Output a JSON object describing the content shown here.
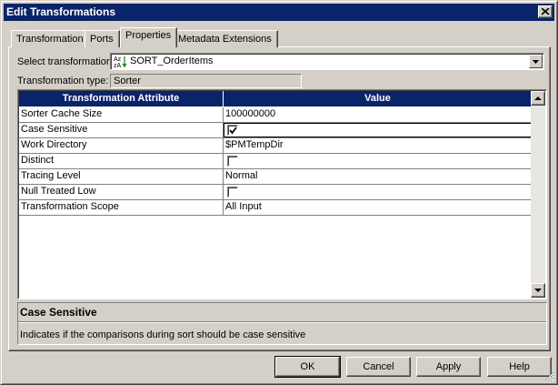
{
  "window": {
    "title": "Edit Transformations"
  },
  "tabs": [
    {
      "label": "Transformation"
    },
    {
      "label": "Ports"
    },
    {
      "label": "Properties",
      "active": true
    },
    {
      "label": "Metadata Extensions"
    }
  ],
  "form": {
    "select_label": "Select transformation:",
    "select_value": "SORT_OrderItems",
    "select_icon": "sorter-transformation-icon",
    "type_label": "Transformation type:",
    "type_value": "Sorter"
  },
  "grid": {
    "columns": [
      "Transformation Attribute",
      "Value"
    ],
    "rows": [
      {
        "attribute": "Sorter Cache Size",
        "value": "100000000",
        "kind": "text"
      },
      {
        "attribute": "Case Sensitive",
        "value": "",
        "kind": "checkbox",
        "checked": true,
        "selected": true
      },
      {
        "attribute": "Work Directory",
        "value": "$PMTempDir",
        "kind": "text"
      },
      {
        "attribute": "Distinct",
        "value": "",
        "kind": "checkbox",
        "checked": false
      },
      {
        "attribute": "Tracing Level",
        "value": "Normal",
        "kind": "text"
      },
      {
        "attribute": "Null Treated Low",
        "value": "",
        "kind": "checkbox",
        "checked": false
      },
      {
        "attribute": "Transformation Scope",
        "value": "All Input",
        "kind": "text"
      }
    ]
  },
  "description": {
    "title": "Case Sensitive",
    "text": "Indicates if the comparisons during sort should be case sensitive"
  },
  "buttons": {
    "ok": "OK",
    "cancel": "Cancel",
    "apply": "Apply",
    "help": "Help"
  },
  "colors": {
    "titlebar": "#0a246a",
    "face": "#d4d0c8",
    "header": "#0a246a"
  }
}
